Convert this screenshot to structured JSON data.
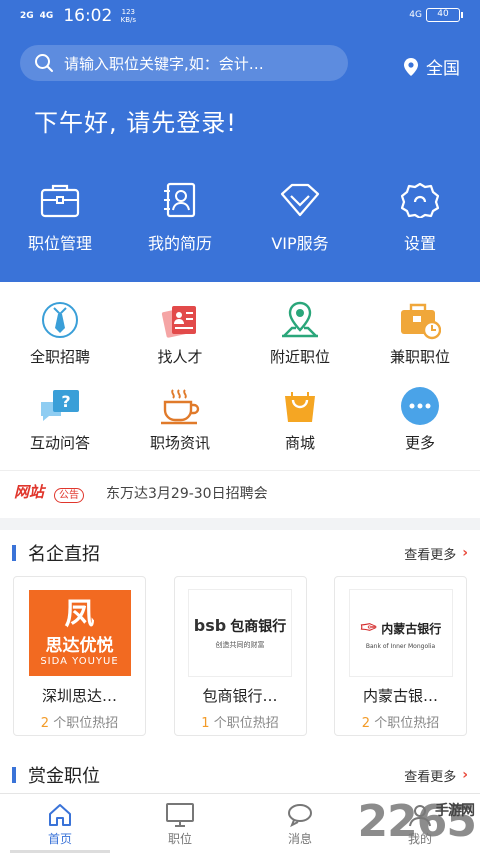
{
  "status": {
    "sig1": "2G",
    "sig2": "4G",
    "time": "16:02",
    "speed": "123\nKB/s",
    "net": "4G",
    "battery": "40"
  },
  "search": {
    "placeholder": "请输入职位关键字,如：会计…",
    "location": "全国"
  },
  "greeting": "下午好, 请先登录!",
  "top_nav": [
    {
      "label": "职位管理",
      "icon": "briefcase-icon"
    },
    {
      "label": "我的简历",
      "icon": "resume-icon"
    },
    {
      "label": "VIP服务",
      "icon": "diamond-icon"
    },
    {
      "label": "设置",
      "icon": "gear-icon"
    }
  ],
  "grid": [
    {
      "label": "全职招聘",
      "icon": "tie-icon"
    },
    {
      "label": "找人才",
      "icon": "talent-cards-icon"
    },
    {
      "label": "附近职位",
      "icon": "map-pin-icon"
    },
    {
      "label": "兼职职位",
      "icon": "briefcase-clock-icon"
    },
    {
      "label": "互动问答",
      "icon": "chat-question-icon"
    },
    {
      "label": "职场资讯",
      "icon": "coffee-cup-icon"
    },
    {
      "label": "商城",
      "icon": "shopping-bag-icon"
    },
    {
      "label": "更多",
      "icon": "more-dots-icon"
    }
  ],
  "notice": {
    "badge_main": "网站",
    "badge_sub": "公告",
    "text": "东万达3月29-30日招聘会"
  },
  "famous": {
    "title": "名企直招",
    "more": "查看更多",
    "companies": [
      {
        "name": "深圳思达…",
        "count": "2",
        "suffix": " 个职位热招",
        "logo_top": "思达优悦",
        "logo_bottom": "SIDA YOUYUE"
      },
      {
        "name": "包商银行…",
        "count": "1",
        "suffix": " 个职位热招",
        "logo_top": "bsb",
        "logo_cn": "包商银行",
        "logo_bottom": "创造共同的财富"
      },
      {
        "name": "内蒙古银…",
        "count": "2",
        "suffix": " 个职位热招",
        "logo_top": "内蒙古银行",
        "logo_bottom": "Bank of Inner Mongolia"
      }
    ]
  },
  "reward": {
    "title": "赏金职位",
    "more": "查看更多"
  },
  "tabs": [
    {
      "label": "首页",
      "icon": "home-icon"
    },
    {
      "label": "职位",
      "icon": "monitor-icon"
    },
    {
      "label": "消息",
      "icon": "message-icon"
    },
    {
      "label": "我的",
      "icon": "user-icon"
    }
  ],
  "watermark": {
    "main": "2265",
    "sub": "手游网"
  },
  "colors": {
    "primary": "#3a73d8",
    "accent_orange": "#f39b28",
    "accent_red": "#e94b3c"
  }
}
